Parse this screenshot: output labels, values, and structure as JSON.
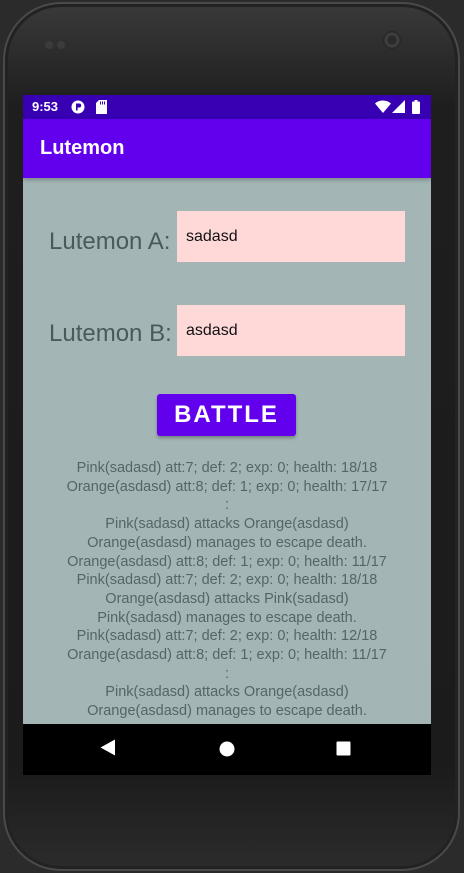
{
  "status_bar": {
    "time": "9:53",
    "left_icons": [
      "accessibility-icon",
      "sd-card-icon"
    ],
    "right_icons": [
      "wifi-icon",
      "signal-icon",
      "battery-icon"
    ]
  },
  "app_bar": {
    "title": "Lutemon"
  },
  "form": {
    "lutemon_a_label": "Lutemon A:",
    "lutemon_a_value": "sadasd",
    "lutemon_b_label": "Lutemon B:",
    "lutemon_b_value": "asdasd"
  },
  "battle_button": {
    "label": "BATTLE"
  },
  "battle_log": [
    "Pink(sadasd) att:7; def: 2; exp: 0; health: 18/18",
    "Orange(asdasd) att:8; def: 1; exp: 0; health: 17/17",
    ":",
    "Pink(sadasd) attacks Orange(asdasd)",
    "Orange(asdasd) manages to escape death.",
    "Orange(asdasd) att:8; def: 1; exp: 0; health: 11/17",
    "Pink(sadasd) att:7; def: 2; exp: 0; health: 18/18",
    "Orange(asdasd) attacks Pink(sadasd)",
    "Pink(sadasd) manages to escape death.",
    "Pink(sadasd) att:7; def: 2; exp: 0; health: 12/18",
    "Orange(asdasd) att:8; def: 1; exp: 0; health: 11/17",
    ":",
    "Pink(sadasd) attacks Orange(asdasd)",
    "Orange(asdasd) manages to escape death."
  ],
  "nav_bar": {
    "buttons": [
      "back-icon",
      "home-icon",
      "recents-icon"
    ]
  },
  "colors": {
    "primary": "#6200ee",
    "primary_dark": "#3700b3",
    "background": "#a3b6b5",
    "field_background": "#ffd8d8"
  }
}
